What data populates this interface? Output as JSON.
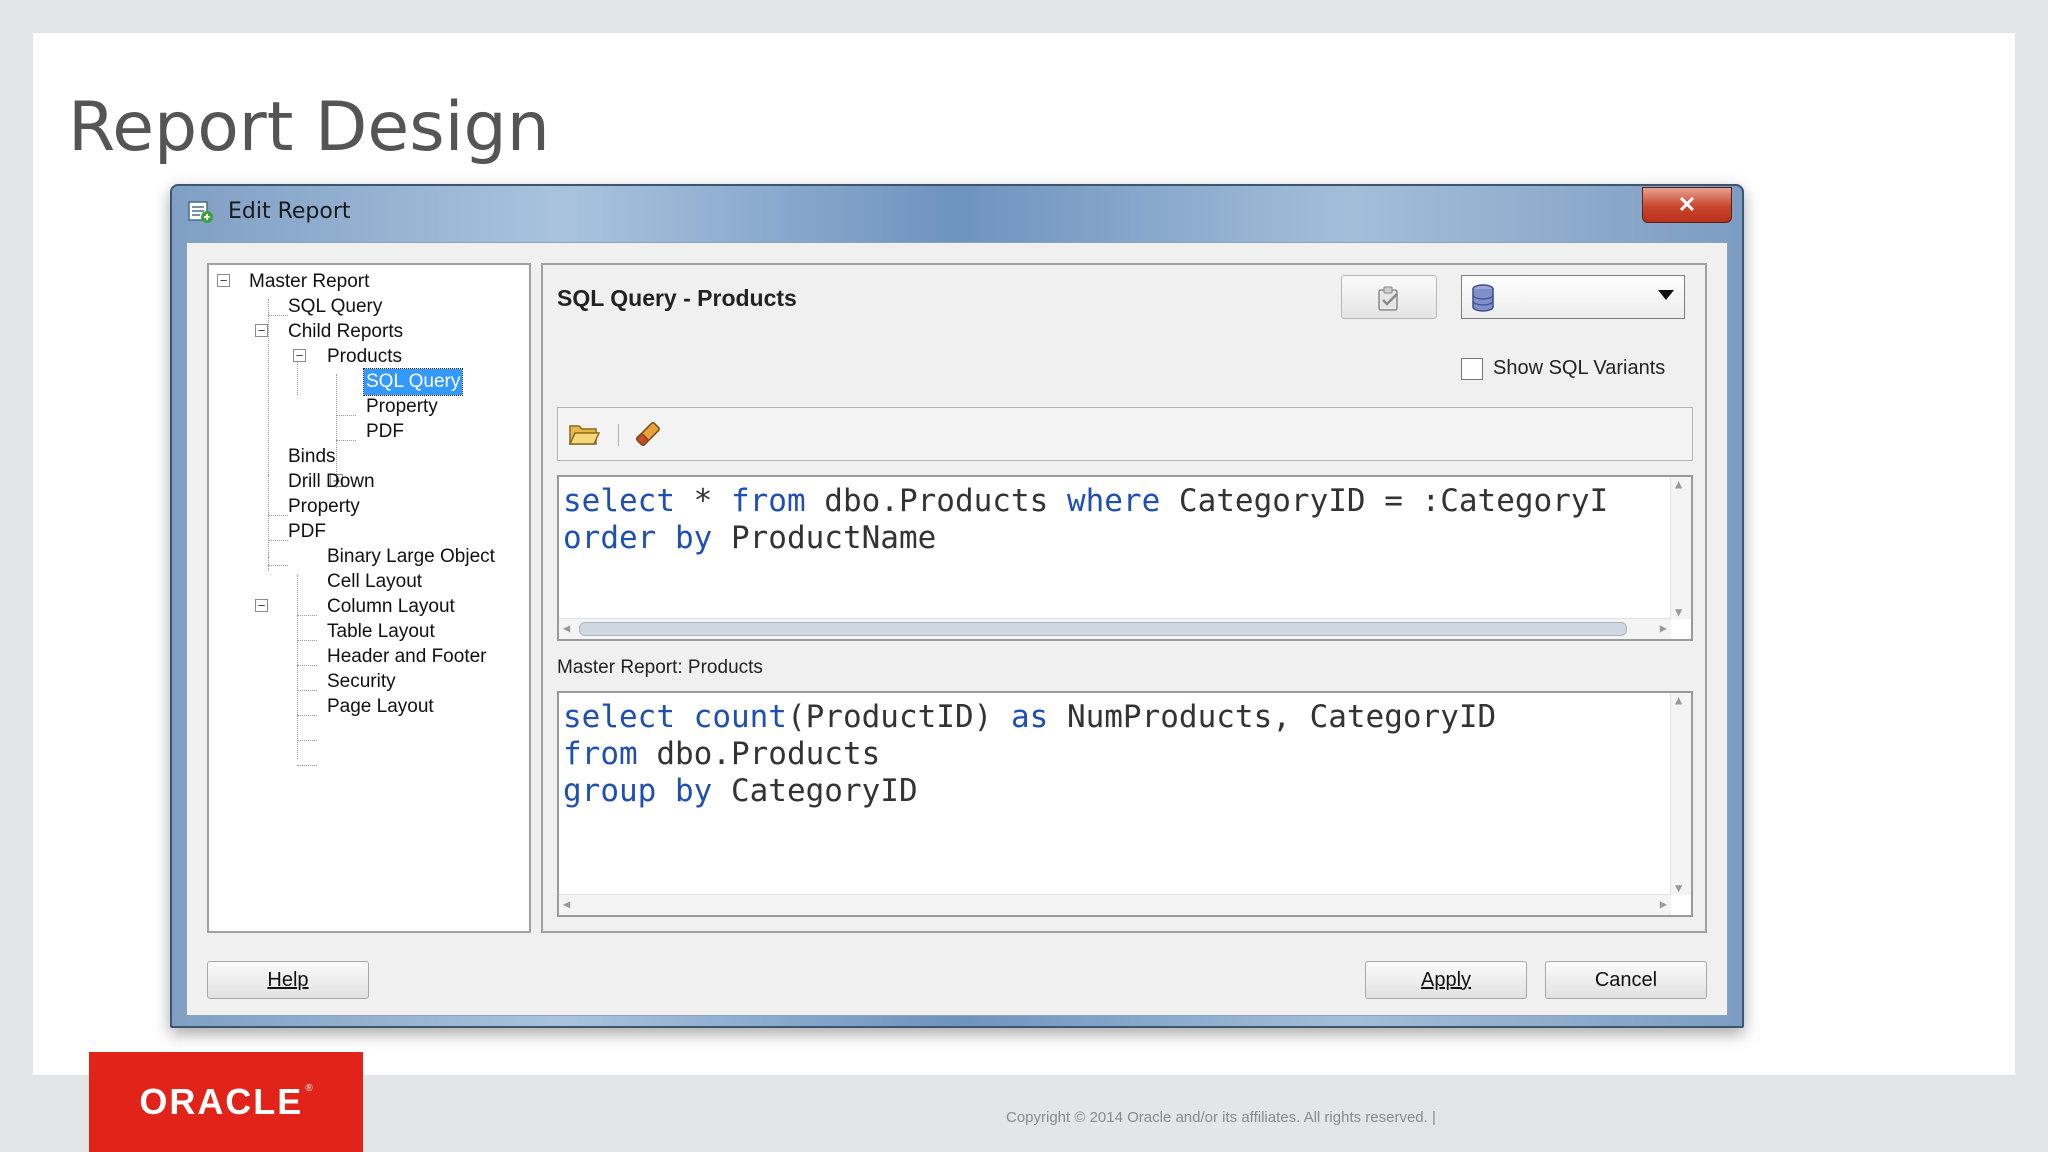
{
  "slide": {
    "title": "Report Design",
    "logo_text": "ORACLE",
    "logo_mark": "®",
    "copyright": "Copyright © 2014 Oracle and/or its affiliates. All rights reserved.  |"
  },
  "window": {
    "title": "Edit Report",
    "close_glyph": "✕"
  },
  "tree": {
    "items": [
      {
        "label": "Master Report",
        "expander": "−"
      },
      {
        "label": "SQL Query"
      },
      {
        "label": "Child Reports",
        "expander": "−"
      },
      {
        "label": "Products",
        "expander": "−"
      },
      {
        "label": "SQL Query",
        "selected": true
      },
      {
        "label": "Property"
      },
      {
        "label": "PDF",
        "expander": "+"
      },
      {
        "label": "Binds"
      },
      {
        "label": "Drill Down"
      },
      {
        "label": "Property"
      },
      {
        "label": "PDF",
        "expander": "−"
      },
      {
        "label": "Binary Large Object"
      },
      {
        "label": "Cell Layout"
      },
      {
        "label": "Column Layout"
      },
      {
        "label": "Table Layout"
      },
      {
        "label": "Header and Footer"
      },
      {
        "label": "Security"
      },
      {
        "label": "Page Layout"
      }
    ]
  },
  "panel": {
    "title": "SQL Query - Products",
    "connection_value": "",
    "show_variants_label": "Show SQL Variants",
    "show_variants_checked": false,
    "toolbar_icons": [
      "folder-open-icon",
      "eraser-icon"
    ],
    "query": {
      "line1": {
        "kw1": "select",
        "t1": " * ",
        "kw2": "from",
        "t2": " dbo.Products ",
        "kw3": "where",
        "t3": " CategoryID = :CategoryI"
      },
      "line2": {
        "kw1": "order by",
        "t1": " ProductName"
      }
    },
    "master_label": "Master Report:  Products",
    "master_query": {
      "line1": {
        "kw1": "select",
        "t1": " ",
        "kw2": "count",
        "t2": "(ProductID) ",
        "kw3": "as",
        "t3": " NumProducts, CategoryID"
      },
      "line2": {
        "kw1": "from",
        "t1": " dbo.Products"
      },
      "line3": {
        "kw1": "group by",
        "t1": " CategoryID"
      }
    }
  },
  "buttons": {
    "help": "Help",
    "apply": "Apply",
    "cancel": "Cancel"
  },
  "colors": {
    "keyword": "#1f4fb3",
    "selection": "#3399ff",
    "logo_red": "#e2231a"
  }
}
